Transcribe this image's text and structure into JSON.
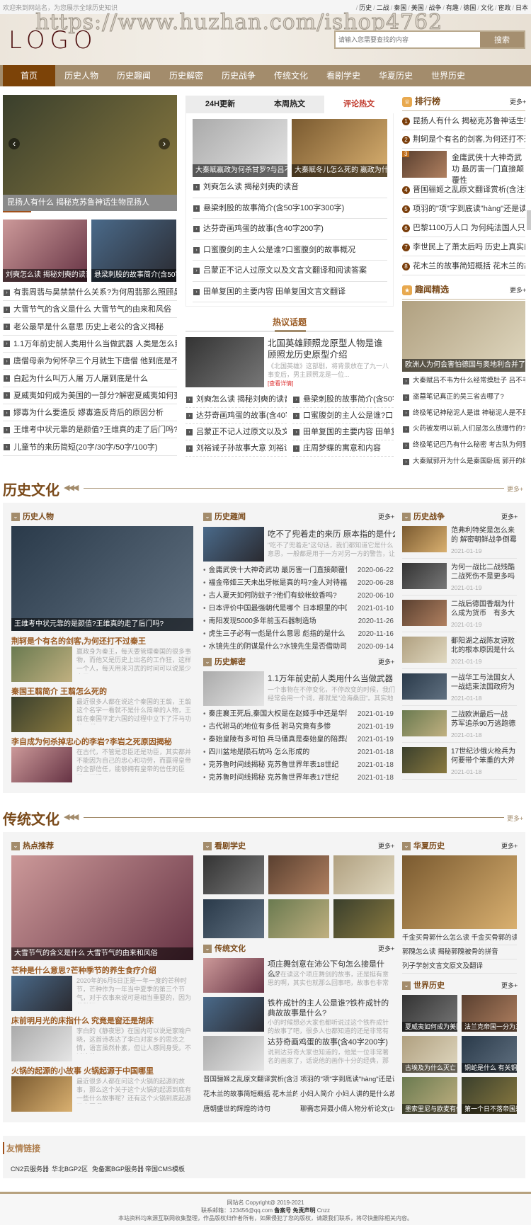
{
  "top": {
    "welcome": "欢迎来到网站名，为您展示全球历史知识",
    "links": [
      "历史",
      "二战",
      "秦国",
      "美国",
      "战争",
      "有趣",
      "德国",
      "文化",
      "宦政",
      "日本"
    ]
  },
  "header": {
    "watermark": "https://www.huzhan.com/ishop4762",
    "logo": "LOGO",
    "search_placeholder": "请输入您需要查找的内容",
    "search_button": "搜索"
  },
  "nav": {
    "active": 0,
    "items": [
      "首页",
      "历史人物",
      "历史趣闻",
      "历史解密",
      "历史战争",
      "传统文化",
      "看剧学史",
      "华夏历史",
      "世界历史"
    ]
  },
  "featured": {
    "slider_caption": "昆扬人有什么 揭秘克苏鲁神话生物昆扬人",
    "thumbs": [
      "刘奭怎么读 揭秘刘奭的读音",
      "悬梁刺股的故事简介(含50字100字300字)"
    ],
    "list": [
      "有翡周翡与昊禁禁什么关系?为何周翡那么照顾昊禁",
      "大雪节气的含义是什么 大雪节气的由来和风俗",
      "老公最早是什么意思 历史上老公的含义揭秘",
      "1.1万年前史前人类用什么当做武器 人类是怎么到达欧",
      "唐僧母亲为何怀孕三个月就生下唐僧 他到底是不是陈",
      "白起为什么叫万人屠 万人屠到底是什么",
      "夏威夷如何成为美国的一部分?解密夏威夷如何变成美",
      "嫪毐为什么要造反 嫪毐造反背后的原因分析",
      "王维考中状元靠的是颜值?王维真的走了后门吗?",
      "儿童节的来历简短(20字/30字/50字/100字)"
    ]
  },
  "tabs": {
    "labels": [
      "24H更新",
      "本周热文",
      "评论热文"
    ],
    "active": 2,
    "thumbs": [
      "大秦赋嬴政为何杀甘罗?与吕不韦有什么关系",
      "大秦赋冬儿怎么死的 嬴政为什么要杀冬儿"
    ],
    "list": [
      "刘奭怎么读 揭秘刘奭的读音",
      "悬梁刺股的故事简介(含50字100字300字)",
      "达芬奇画鸡蛋的故事(含40字200字)",
      "口蜜腹剑的主人公是谁?口蜜腹剑的故事概况",
      "吕蒙正不记人过原文以及文言文翻译和阅读答案",
      "田单复国的主要内容 田单复国文言文翻译"
    ]
  },
  "hot_topic": {
    "title": "热议话题",
    "feature": {
      "title": "北国英雄顾照龙原型人物是谁 顾照龙历史原型介绍",
      "summary": "《北国英雄》这部剧，将背景放在了九一八事变后，男主顾照龙是一位...",
      "more": "[查看详情]"
    },
    "list": [
      "刘奭怎么读 揭秘刘奭的读音",
      "悬梁刺股的故事简介(含50字",
      "达芬奇画鸡蛋的故事(含40字",
      "口蜜腹剑的主人公是谁?口蜜",
      "吕蒙正不记人过原文以及文言",
      "田单复国的主要内容 田单复国",
      "刘裕诫子孙故事大意 刘裕诫子",
      "庄周梦蝶的寓意和内容"
    ]
  },
  "ranking": {
    "title": "排行榜",
    "more": "更多+",
    "items": [
      "昆扬人有什么 揭秘克苏鲁神话生物",
      "荆轲是个有名的剑客,为何还打不过",
      "金庸武侠十大神奇武功 最厉害一门直接颠覆性",
      "晋国骊姬之乱原文翻译赏析(含注释)",
      "项羽的\"项\"字到底读\"hàng\"还是读",
      "巴黎1100万人口 为何纯法国人只有",
      "李世民上了萧太后吗 历史上真实的",
      "花木兰的故事简短概括 花木兰的故"
    ]
  },
  "fun": {
    "title": "趣闻精选",
    "more": "更多+",
    "image_caption": "欧洲人为何会害怕德国与奥地利合并了?",
    "list": [
      "大秦赋吕不韦为什么经常摸肚子 吕不韦摸",
      "盗墓笔记真正的吴三省去哪了?",
      "终极笔记神秘泥人是谁 神秘泥人是不是陈",
      "火药被发明以前,人们是怎么放爆竹的?",
      "终极笔记巴乃有什么秘密 考古队为何要来",
      "大秦赋郭开为什么是秦国卧底 郭开的结局"
    ]
  },
  "history": {
    "title": "历史文化",
    "more": "更多+",
    "people": {
      "title": "历史人物",
      "image_caption": "王维考中状元靠的是颜值?王维真的走了后门吗?",
      "articles": [
        {
          "title": "荆轲是个有名的剑客,为何还打不过秦王",
          "summary": "嬴政身为秦王，每天要管理秦国的很多事物，而他又是历史上出名的工作狂，这样一个人，每天用来习武的时间可以说是少之又"
        },
        {
          "title": "秦国王翦简介 王翦怎么死的",
          "summary": "最近很多人都在说这个秦国的王翦，王翦这个名字一看就不是什么简单的人物，王翦在秦国平定六国的过程中立下了汗马功劳，所"
        },
        {
          "title": "李自成为何杀掉忠心的李岩?李岩之死原因揭秘",
          "summary": "在古代，不管是忠臣还是功臣，其实都并不能因为自己的忠心和功劳，而赢得皇帝的全部信任，能够拥有皇帝的信任的臣子，无疑"
        }
      ]
    },
    "trivia": {
      "title": "历史趣闻",
      "more": "更多+",
      "feature": {
        "title": "吃不了兜着走的来历 原本指的是什么",
        "summary": "\"吃不了兜着走\"这句话，我们都知道它是什么意思，一般都是用于一方对另一方的警告，让"
      },
      "list": [
        {
          "title": "金庸武侠十大神奇武功 最厉害一门直接颠覆性",
          "date": "2020-06-22"
        },
        {
          "title": "福金帝姬三天未出牙帐是真的吗?金人对待福",
          "date": "2020-06-28"
        },
        {
          "title": "古人夏天如何防蚊子?他们有蚊帐蚊香吗?",
          "date": "2020-06-10"
        },
        {
          "title": "日本评价中国最强朝代是哪个 日本眼里的中国",
          "date": "2021-01-10"
        },
        {
          "title": "南阳发现5000多年前玉石器制造场",
          "date": "2020-11-26"
        },
        {
          "title": "虎生三子必有一彪是什么意思 彪指的是什么",
          "date": "2020-11-16"
        },
        {
          "title": "水镜先生的阴谋是什么?水镜先生是否借助司",
          "date": "2020-09-14"
        }
      ]
    },
    "secrets": {
      "title": "历史解密",
      "more": "更多+",
      "feature": {
        "title": "1.1万年前史前人类用什么当做武器",
        "summary": "一个事物在不停变化，不停改变的时候，我们经常会用一个词，那就是\"沧海桑田\"。其实地"
      },
      "list": [
        {
          "title": "秦庄襄王死后,秦国大权是在赵姬手中还是华阳",
          "date": "2021-01-19"
        },
        {
          "title": "古代驸马的地位有多低 驸马究竟有多惨",
          "date": "2021-01-19"
        },
        {
          "title": "秦始皇陵有多可怕 兵马俑真是秦始皇的陪葬品",
          "date": "2021-01-19"
        },
        {
          "title": "四川盆地是陨石坑吗 怎么形成的",
          "date": "2021-01-18"
        },
        {
          "title": "克苏鲁时间线揭秘 克苏鲁世界年表18世纪",
          "date": "2021-01-18"
        },
        {
          "title": "克苏鲁时间线揭秘 克苏鲁世界年表17世纪",
          "date": "2021-01-18"
        }
      ]
    },
    "war": {
      "title": "历史战争",
      "more": "更多+",
      "items": [
        {
          "title": "范弗利特奖是怎么来的 解密朝鲜战争倒霉蛋范",
          "date": "2021-01-19"
        },
        {
          "title": "为何一战比二战残酷 二战死伤不是更多吗",
          "date": "2021-01-19"
        },
        {
          "title": "二战后德国香烟为什么成为货币　有多大的购",
          "date": "2021-01-19"
        },
        {
          "title": "鄱阳湖之战陈友谅败北的根本原因是什么",
          "date": "2021-01-19"
        },
        {
          "title": "一战华工与法国女人 一战结束法国政府为何",
          "date": "2021-01-18"
        },
        {
          "title": "二战欧洲最后一战　苏军追杀90万逃跑德军",
          "date": "2021-01-18"
        },
        {
          "title": "17世纪沙俄火枪兵为何要带个笨重的大斧",
          "date": "2021-01-18"
        }
      ]
    }
  },
  "culture": {
    "title": "传统文化",
    "more": "更多+",
    "hot": {
      "title": "热点推荐",
      "image_caption": "大雪节气的含义是什么 大雪节气的由来和风俗",
      "articles": [
        {
          "title": "芒种是什么意思?芒种季节的养生食疗介绍",
          "summary": "2020年的6月5日正是一年一度的芒种时节，芒种作为一年当中夏季的第三个节气，对于农事来说可是相当重要的，因为芒种还"
        },
        {
          "title": "床前明月光的床指什么 究竟是窗还是胡床",
          "summary": "李白的《静夜思》在国内可以说是家喻户晓，这首诗表达了李白对家乡的思念之情，语言虽然朴素，但让人感同身受。不过这首"
        },
        {
          "title": "火锅的起源的小故事 火锅起源于中国哪里",
          "summary": "最近很多人都在问这个火锅的起源的故事，那么这个关于这个火锅的起源到底有一些什么故事呢？还有这个火锅到底起源于中国哪"
        }
      ]
    },
    "drama": {
      "title": "看剧学史",
      "more": "更多+"
    },
    "tradition": {
      "title": "传统文化",
      "more": "更多+",
      "features": [
        {
          "title": "项庄舞剑意在沛公下句怎么接是什么?",
          "summary": "最近在读这个项庄舞剑的故事，还是挺有意思的啊，其实也就那么回事吧，故事也非常的精"
        },
        {
          "title": "铁杵成针的主人公是谁?铁杵成针的典故故事是什么?",
          "summary": "小的时候想必大家也都听说过这个铁杵成针的故事了吧，很多人也都知道的还是非常有意思"
        },
        {
          "title": "达芬奇画鸡蛋的故事(含40字200字)",
          "summary": "说到达芬奇大家也知道的，他是一位非常著名的画家了，话说他的画作十分的经典，那么有"
        }
      ],
      "links": [
        "晋国骊姬之乱原文翻译赏析(含注",
        "项羽的\"项\"字到底读\"hàng\"还是读",
        "花木兰的故事简短概括 花木兰的故",
        "小妇人简介 小妇人讲的是什么故事",
        "唐朝盛世的辉煌的诗句",
        "聊斋志异聂小倩人物分析论文(100"
      ]
    },
    "china": {
      "title": "华夏历史",
      "more": "更多+",
      "list": [
        "千金买骨郭什么怎么读 千金买骨郭的读音",
        "郭隗怎么读 揭秘郭隗被骨的拼音",
        "列子学射文言文原文及翻译"
      ]
    },
    "world": {
      "title": "世界历史",
      "more": "更多+",
      "captions": [
        "夏威夷如何成为美国的",
        "法兰克帝国一分为三分",
        "古埃及为什么灭亡",
        "铜蛇是什么 有关铜蛇的",
        "墨索里尼与欧麦有什么",
        "第一个日不落帝国是哪"
      ]
    }
  },
  "friends": {
    "title": "友情链接",
    "links": [
      "CN2云服务器",
      "华北BGP2区",
      "免备案BGP服务器",
      "帝国CMS模板"
    ]
  },
  "footer": {
    "copyright": "网站名 Copyright@ 2019-2021",
    "email": "联系邮箱：123456@qq.com",
    "icp": "备案号",
    "disclaimer": "免责声明",
    "cnzz": "Cnzz",
    "notice": "本站资料均来源互联网收集整理，作品版权归作者所有，如果侵犯了您的版权，请跟我们联系，将尽快删除相关内容。"
  },
  "colors": {
    "nav": "#a38c6c",
    "nav_active": "#7c4308",
    "heading": "#7a4a1a",
    "accent_red": "#c0392b"
  }
}
